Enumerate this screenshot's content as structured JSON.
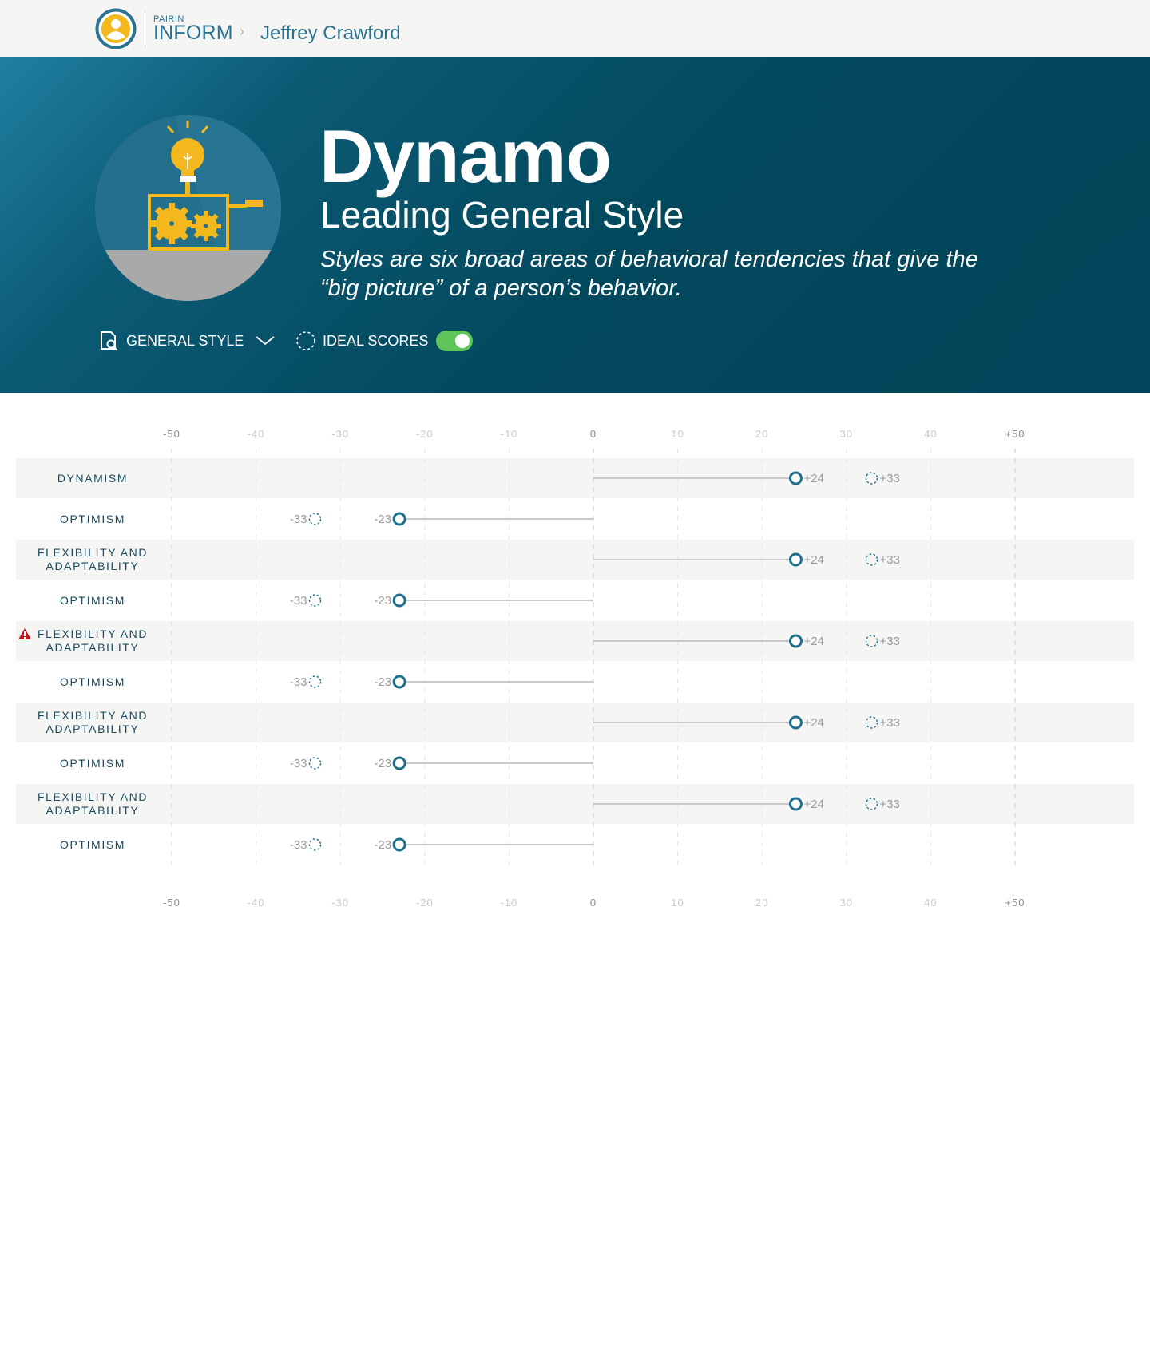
{
  "header": {
    "brand_small": "PAIRIN",
    "brand_big": "INFORM",
    "breadcrumb_separator": "›",
    "person_name": "Jeffrey Crawford"
  },
  "hero": {
    "title": "Dynamo",
    "subtitle": "Leading General Style",
    "description": "Styles are six broad areas of behavioral tendencies that give the “big picture” of a person’s behavior.",
    "style_selector_label": "GENERAL STYLE",
    "ideal_scores_label": "IDEAL SCORES",
    "ideal_scores_enabled": true
  },
  "colors": {
    "accent": "#1f6f8b",
    "hero_bg": "#034a5f",
    "toggle_on": "#5fc45a",
    "warning": "#c0141e",
    "row_shade": "#f5f5f4"
  },
  "chart_data": {
    "type": "bar",
    "xlim": [
      -50,
      50
    ],
    "ticks": [
      "-50",
      "-40",
      "-30",
      "-20",
      "-10",
      "0",
      "10",
      "20",
      "30",
      "40",
      "+50"
    ],
    "ideal_marker_style": "dashed-circle",
    "score_marker_style": "open-circle",
    "rows": [
      {
        "label": "DYNAMISM",
        "score": 24,
        "score_label": "+24",
        "ideal": 33,
        "ideal_label": "+33",
        "warning": false
      },
      {
        "label": "OPTIMISM",
        "score": -23,
        "score_label": "-23",
        "ideal": -33,
        "ideal_label": "-33",
        "warning": false
      },
      {
        "label": "FLEXIBILITY AND ADAPTABILITY",
        "score": 24,
        "score_label": "+24",
        "ideal": 33,
        "ideal_label": "+33",
        "warning": false
      },
      {
        "label": "OPTIMISM",
        "score": -23,
        "score_label": "-23",
        "ideal": -33,
        "ideal_label": "-33",
        "warning": false
      },
      {
        "label": "FLEXIBILITY AND ADAPTABILITY",
        "score": 24,
        "score_label": "+24",
        "ideal": 33,
        "ideal_label": "+33",
        "warning": true
      },
      {
        "label": "OPTIMISM",
        "score": -23,
        "score_label": "-23",
        "ideal": -33,
        "ideal_label": "-33",
        "warning": false
      },
      {
        "label": "FLEXIBILITY AND ADAPTABILITY",
        "score": 24,
        "score_label": "+24",
        "ideal": 33,
        "ideal_label": "+33",
        "warning": false
      },
      {
        "label": "OPTIMISM",
        "score": -23,
        "score_label": "-23",
        "ideal": -33,
        "ideal_label": "-33",
        "warning": false
      },
      {
        "label": "FLEXIBILITY AND ADAPTABILITY",
        "score": 24,
        "score_label": "+24",
        "ideal": 33,
        "ideal_label": "+33",
        "warning": false
      },
      {
        "label": "OPTIMISM",
        "score": -23,
        "score_label": "-23",
        "ideal": -33,
        "ideal_label": "-33",
        "warning": false
      }
    ]
  }
}
